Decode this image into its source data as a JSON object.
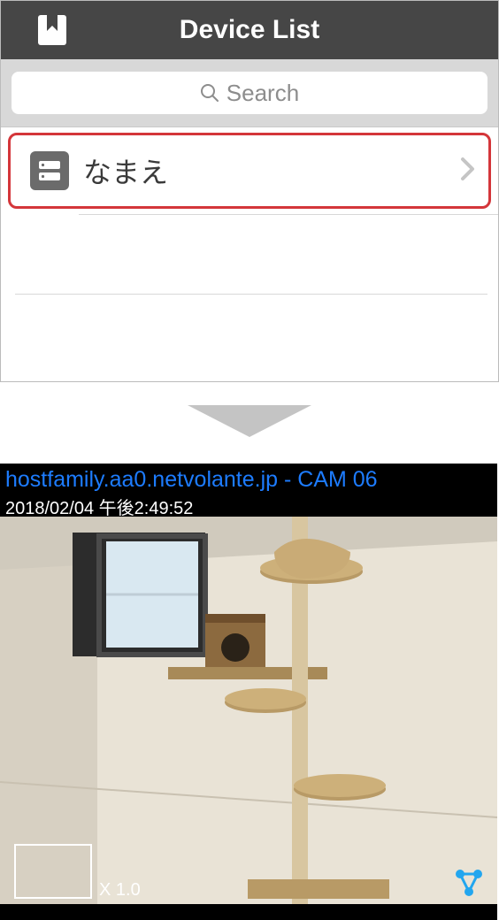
{
  "header": {
    "title": "Device List"
  },
  "search": {
    "placeholder": "Search"
  },
  "deviceList": {
    "items": [
      {
        "label": "なまえ"
      }
    ]
  },
  "camera": {
    "title": "hostfamily.aa0.netvolante.jp - CAM 06",
    "timestamp": "2018/02/04 午後2:49:52",
    "zoomLabel": "X 1.0"
  }
}
